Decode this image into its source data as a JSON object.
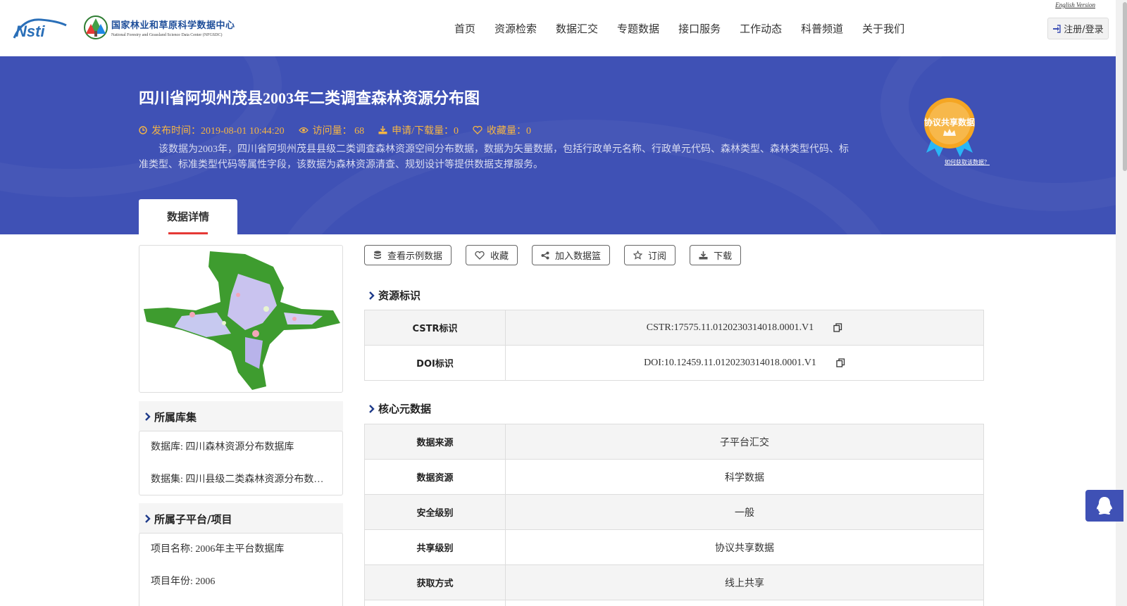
{
  "header": {
    "logo_nsti_text": "Nsti",
    "logo_title_cn": "国家林业和草原科学数据中心",
    "logo_title_en": "National Forestry and Grassland Science Data Center (NFGSDC)",
    "english_link": "English Version",
    "nav": [
      "首页",
      "资源检索",
      "数据汇交",
      "专题数据",
      "接口服务",
      "工作动态",
      "科普频道",
      "关于我们"
    ],
    "login_label": "注册/登录"
  },
  "banner": {
    "title": "四川省阿坝州茂县2003年二类调查森林资源分布图",
    "publish": "发布时间：2019-08-01 10:44:20",
    "visits": "访问量： 68",
    "downloads": "申请/下载量：0",
    "favorites": "收藏量：0",
    "description": "该数据为2003年，四川省阿坝州茂县县级二类调查森林资源空间分布数据，数据为矢量数据，包括行政单元名称、行政单元代码、森林类型、森林类型代码、标准类型、标准类型代码等属性字段，该数据为森林资源清查、规划设计等提供数据支撑服务。",
    "badge_text": "协议共享数据",
    "badge_link": "如何获取该数据？",
    "tab_label": "数据详情"
  },
  "sidebar": {
    "library_title": "所属库集",
    "library_rows": [
      "数据库: 四川森林资源分布数据库",
      "数据集: 四川县级二类森林资源分布数据集"
    ],
    "project_title": "所属子平台/项目",
    "project_rows": [
      "项目名称: 2006年主平台数据库",
      "项目年份: 2006"
    ]
  },
  "actions": {
    "sample": "查看示例数据",
    "favorite": "收藏",
    "basket": "加入数据篮",
    "subscribe": "订阅",
    "download": "下载"
  },
  "resource_id": {
    "title": "资源标识",
    "rows": [
      {
        "label": "CSTR标识",
        "value": "CSTR:17575.11.0120230314018.0001.V1"
      },
      {
        "label": "DOI标识",
        "value": "DOI:10.12459.11.0120230314018.0001.V1"
      }
    ]
  },
  "core_meta": {
    "title": "核心元数据",
    "rows": [
      {
        "label": "数据来源",
        "value": "子平台汇交"
      },
      {
        "label": "数据资源",
        "value": "科学数据"
      },
      {
        "label": "安全级别",
        "value": "一般"
      },
      {
        "label": "共享级别",
        "value": "协议共享数据"
      },
      {
        "label": "获取方式",
        "value": "线上共享"
      }
    ]
  },
  "colors": {
    "banner": "#3f51b5",
    "meta": "#f5b544",
    "accent_red": "#e53935"
  },
  "icons": [
    "clock-icon",
    "eye-icon",
    "download-icon",
    "heart-icon",
    "login-icon",
    "database-icon",
    "share-icon",
    "star-icon",
    "copy-icon",
    "chevron-right-icon",
    "qq-icon"
  ]
}
